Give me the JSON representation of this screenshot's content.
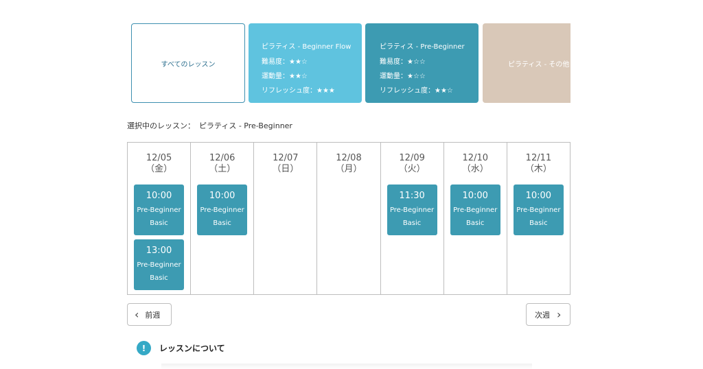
{
  "cards": {
    "all": {
      "label": "すべてのレッスン"
    },
    "flow": {
      "title": "ピラティス - Beginner Flow",
      "difficulty": "難易度：★★☆",
      "exercise": "運動量：★★☆",
      "refresh": "リフレッシュ度：★★★"
    },
    "pre": {
      "title": "ピラティス - Pre-Beginner",
      "difficulty": "難易度：★☆☆",
      "exercise": "運動量：★☆☆",
      "refresh": "リフレッシュ度：★★☆"
    },
    "other": {
      "title": "ピラティス - その他"
    }
  },
  "selected": {
    "label": "選択中のレッスン：",
    "value": "ピラティス - Pre-Beginner"
  },
  "days": [
    {
      "date": "12/05",
      "weekday": "（金）"
    },
    {
      "date": "12/06",
      "weekday": "（土）"
    },
    {
      "date": "12/07",
      "weekday": "（日）"
    },
    {
      "date": "12/08",
      "weekday": "（月）"
    },
    {
      "date": "12/09",
      "weekday": "（火）"
    },
    {
      "date": "12/10",
      "weekday": "（水）"
    },
    {
      "date": "12/11",
      "weekday": "（木）"
    }
  ],
  "slots": {
    "d0a": {
      "time": "10:00",
      "l1": "Pre-Beginner",
      "l2": "Basic"
    },
    "d0b": {
      "time": "13:00",
      "l1": "Pre-Beginner",
      "l2": "Basic"
    },
    "d1a": {
      "time": "10:00",
      "l1": "Pre-Beginner",
      "l2": "Basic"
    },
    "d4a": {
      "time": "11:30",
      "l1": "Pre-Beginner",
      "l2": "Basic"
    },
    "d5a": {
      "time": "10:00",
      "l1": "Pre-Beginner",
      "l2": "Basic"
    },
    "d6a": {
      "time": "10:00",
      "l1": "Pre-Beginner",
      "l2": "Basic"
    }
  },
  "nav": {
    "prev": "前週",
    "next": "次週"
  },
  "about": {
    "icon": "!",
    "title": "レッスンについて"
  },
  "colors": {
    "accent": "#3d9bb2",
    "light_accent": "#5fc3df",
    "beige": "#d9c8b8"
  }
}
